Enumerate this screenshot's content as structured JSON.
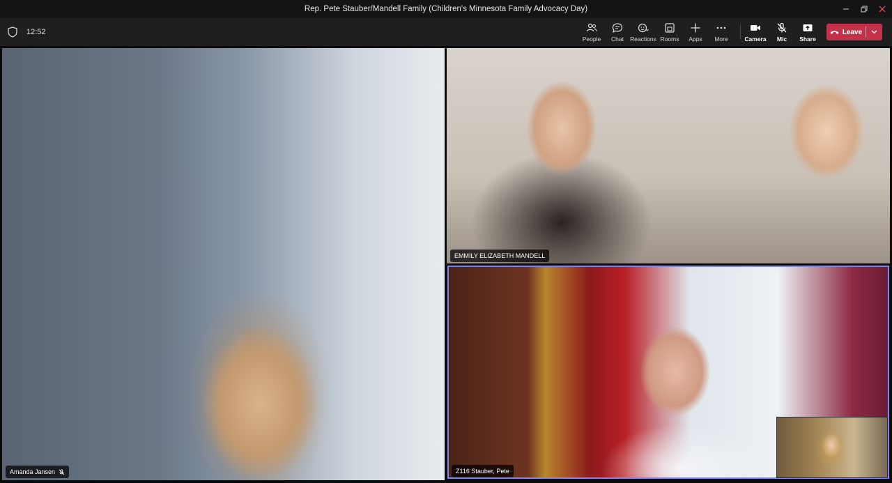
{
  "window": {
    "title": "Rep. Pete Stauber/Mandell Family (Children's Minnesota Family Advocacy Day)"
  },
  "meeting": {
    "elapsed": "12:52"
  },
  "toolbar": {
    "people": "People",
    "chat": "Chat",
    "reactions": "Reactions",
    "rooms": "Rooms",
    "apps": "Apps",
    "more": "More",
    "camera": "Camera",
    "mic": "Mic",
    "share": "Share",
    "leave": "Leave"
  },
  "participants": [
    {
      "name": "Amanda Jansen",
      "muted": true
    },
    {
      "name": "EMMILY ELIZABETH MANDELL",
      "muted": false
    },
    {
      "name": "Z116 Stauber, Pete",
      "muted": false,
      "active_speaker": true
    }
  ],
  "colors": {
    "leave": "#c4314b",
    "active_speaker_border": "#7f85f5",
    "toolbar_bg": "#1f1f1f",
    "titlebar_bg": "#141414"
  }
}
